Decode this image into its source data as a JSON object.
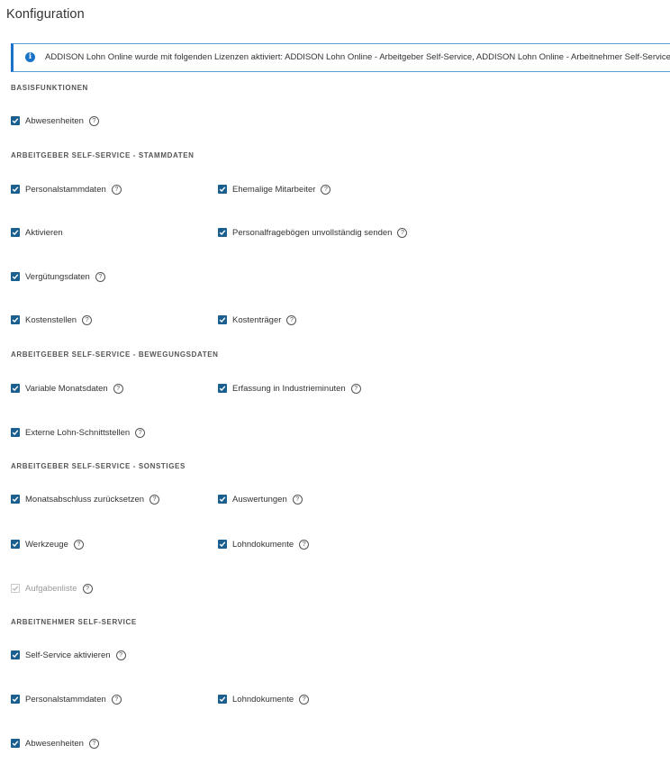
{
  "page": {
    "title": "Konfiguration"
  },
  "info": {
    "icon": "info-icon",
    "text": "ADDISON Lohn Online wurde mit folgenden Lizenzen aktiviert: ADDISON Lohn Online - Arbeitgeber Self-Service, ADDISON Lohn Online - Arbeitnehmer Self-Service"
  },
  "colors": {
    "checkbox": "#1b5f8f",
    "info_accent": "#1a73c9"
  },
  "sections": {
    "basis": {
      "title": "BASISFUNKTIONEN",
      "items": [
        {
          "label": "Abwesenheiten",
          "checked": true
        }
      ]
    },
    "stammdaten": {
      "title": "ARBEITGEBER SELF-SERVICE - STAMMDATEN",
      "items": [
        {
          "label": "Personalstammdaten",
          "checked": true
        },
        {
          "label": "Ehemalige Mitarbeiter",
          "checked": true
        },
        {
          "label": "Aktivieren",
          "checked": true
        },
        {
          "label": "Personalfragebögen unvollständig senden",
          "checked": true
        },
        {
          "label": "Vergütungsdaten",
          "checked": true
        },
        {
          "label": "Kostenstellen",
          "checked": true
        },
        {
          "label": "Kostenträger",
          "checked": true
        }
      ]
    },
    "bewegungsdaten": {
      "title": "ARBEITGEBER SELF-SERVICE - BEWEGUNGSDATEN",
      "items": [
        {
          "label": "Variable Monatsdaten",
          "checked": true
        },
        {
          "label": "Erfassung in Industrieminuten",
          "checked": true
        },
        {
          "label": "Externe Lohn-Schnittstellen",
          "checked": true
        }
      ]
    },
    "sonstiges": {
      "title": "ARBEITGEBER SELF-SERVICE - SONSTIGES",
      "items": [
        {
          "label": "Monatsabschluss zurücksetzen",
          "checked": true
        },
        {
          "label": "Auswertungen",
          "checked": true
        },
        {
          "label": "Werkzeuge",
          "checked": true
        },
        {
          "label": "Lohndokumente",
          "checked": true
        },
        {
          "label": "Aufgabenliste",
          "checked": true,
          "disabled": true
        }
      ]
    },
    "arbeitnehmer": {
      "title": "ARBEITNEHMER SELF-SERVICE",
      "items": [
        {
          "label": "Self-Service aktivieren",
          "checked": true
        },
        {
          "label": "Personalstammdaten",
          "checked": true
        },
        {
          "label": "Lohndokumente",
          "checked": true
        },
        {
          "label": "Abwesenheiten",
          "checked": true
        }
      ]
    }
  },
  "help_glyph": "?"
}
